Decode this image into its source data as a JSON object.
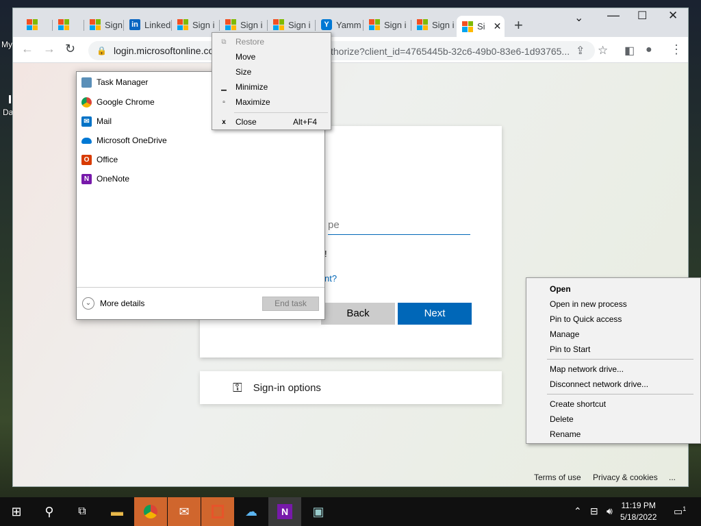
{
  "desktop": {
    "labels": [
      "My",
      "Da"
    ]
  },
  "browser": {
    "tabs": [
      {
        "icon": "ms",
        "label": ""
      },
      {
        "icon": "ms",
        "label": ""
      },
      {
        "icon": "ms",
        "label": "Sign i"
      },
      {
        "icon": "linkedin",
        "label": "Linked"
      },
      {
        "icon": "ms",
        "label": "Sign i"
      },
      {
        "icon": "ms",
        "label": "Sign i"
      },
      {
        "icon": "ms",
        "label": "Sign i"
      },
      {
        "icon": "yammer",
        "label": "Yamm"
      },
      {
        "icon": "ms",
        "label": "Sign i"
      },
      {
        "icon": "ms",
        "label": "Sign i"
      },
      {
        "icon": "ms",
        "label": "Si",
        "active": true
      }
    ],
    "url": "login.microsoftonline.co",
    "url_tail": "thorize?client_id=4765445b-32c6-49b0-83e6-1d93765..."
  },
  "signin": {
    "placeholder_fragment": "pe",
    "frag_exclaim": "!",
    "frag_link": "nt?",
    "back_label": "Back",
    "next_label": "Next",
    "options_label": "Sign-in options",
    "footer": {
      "terms": "Terms of use",
      "privacy": "Privacy & cookies",
      "more": "..."
    }
  },
  "task_manager": {
    "apps": [
      {
        "name": "Task Manager",
        "icon": "task-manager-icon",
        "color": "#5a8fb8"
      },
      {
        "name": "Google Chrome",
        "icon": "chrome-icon",
        "color": "#db4437"
      },
      {
        "name": "Mail",
        "icon": "mail-icon",
        "color": "#0072c6"
      },
      {
        "name": "Microsoft OneDrive",
        "icon": "onedrive-icon",
        "color": "#0078d4"
      },
      {
        "name": "Office",
        "icon": "office-icon",
        "color": "#d83b01"
      },
      {
        "name": "OneNote",
        "icon": "onenote-icon",
        "color": "#7719aa"
      }
    ],
    "more_details": "More details",
    "end_task": "End task"
  },
  "system_menu": {
    "items": [
      {
        "label": "Restore",
        "disabled": true,
        "icon": "restore-icon"
      },
      {
        "label": "Move",
        "disabled": false,
        "icon": ""
      },
      {
        "label": "Size",
        "disabled": false,
        "icon": ""
      },
      {
        "label": "Minimize",
        "disabled": false,
        "icon": "minimize-icon"
      },
      {
        "label": "Maximize",
        "disabled": false,
        "icon": "maximize-icon"
      },
      {
        "label": "Close",
        "disabled": false,
        "icon": "close-icon",
        "accel": "Alt+F4"
      }
    ]
  },
  "context_menu": {
    "group1": [
      "Open",
      "Open in new process",
      "Pin to Quick access",
      "Manage",
      "Pin to Start"
    ],
    "group2": [
      "Map network drive...",
      "Disconnect network drive..."
    ],
    "group3": [
      "Create shortcut",
      "Delete",
      "Rename"
    ]
  },
  "taskbar": {
    "time": "11:19 PM",
    "date": "5/18/2022",
    "notifications": "1"
  }
}
